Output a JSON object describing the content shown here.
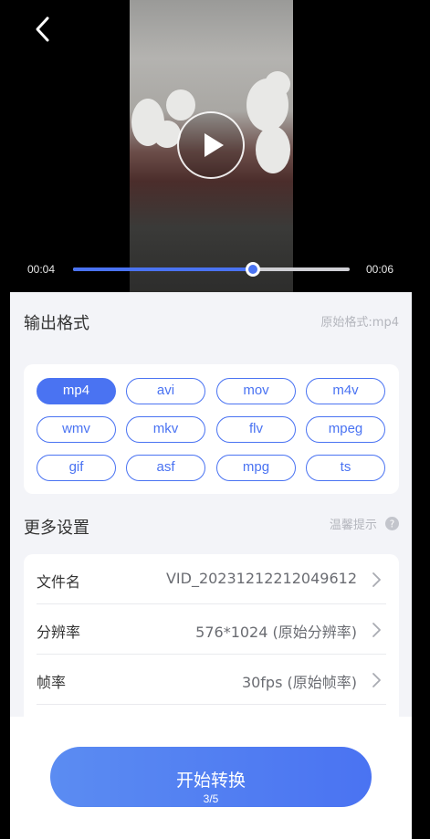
{
  "player": {
    "current_time": "00:04",
    "total_time": "00:06",
    "progress": 0.65
  },
  "output_format": {
    "title": "输出格式",
    "original_hint": "原始格式:mp4",
    "options": [
      "mp4",
      "avi",
      "mov",
      "m4v",
      "wmv",
      "mkv",
      "flv",
      "mpeg",
      "gif",
      "asf",
      "mpg",
      "ts"
    ],
    "selected": "mp4"
  },
  "more_settings": {
    "title": "更多设置",
    "tip_label": "温馨提示",
    "rows": [
      {
        "label": "文件名",
        "value": "VID_20231212212049612"
      },
      {
        "label": "分辨率",
        "value": "576*1024 (原始分辨率)"
      },
      {
        "label": "帧率",
        "value": "30fps (原始帧率)"
      }
    ]
  },
  "convert": {
    "label": "开始转换",
    "page_indicator": "3/5"
  },
  "colors": {
    "accent": "#4a73f2",
    "panel_bg": "#f3f4f8"
  }
}
